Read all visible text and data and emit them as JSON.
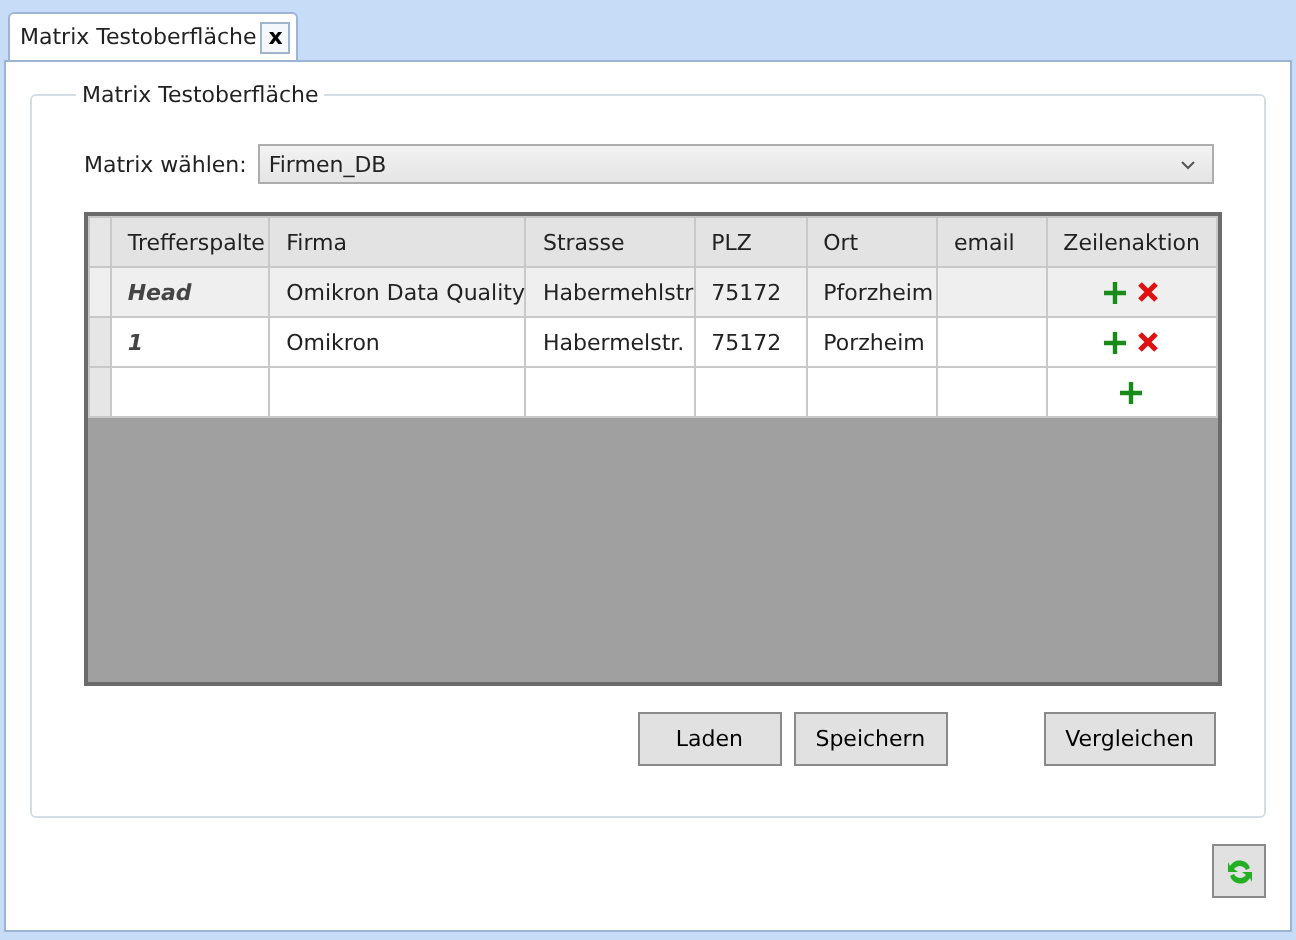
{
  "tab": {
    "label": "Matrix Testoberfläche",
    "close": "x"
  },
  "fieldset": {
    "legend": "Matrix Testoberfläche"
  },
  "matrix_select": {
    "label": "Matrix wählen:",
    "value": "Firmen_DB"
  },
  "table": {
    "columns": [
      "Trefferspalte",
      "Firma",
      "Strasse",
      "PLZ",
      "Ort",
      "email",
      "Zeilenaktion"
    ],
    "rows": [
      {
        "kind": "head",
        "cells": [
          "Head",
          "Omikron Data Quality",
          "Habermehlstr",
          "75172",
          "Pforzheim"
        ],
        "can_add": true,
        "can_delete": true
      },
      {
        "kind": "data",
        "cells": [
          "1",
          "Omikron",
          "Habermelstr.",
          "75172",
          "Porzheim"
        ],
        "can_add": true,
        "can_delete": true
      },
      {
        "kind": "new",
        "can_add": true,
        "can_delete": false
      }
    ]
  },
  "buttons": [
    "Laden",
    "Speichern",
    "Vergleichen"
  ]
}
